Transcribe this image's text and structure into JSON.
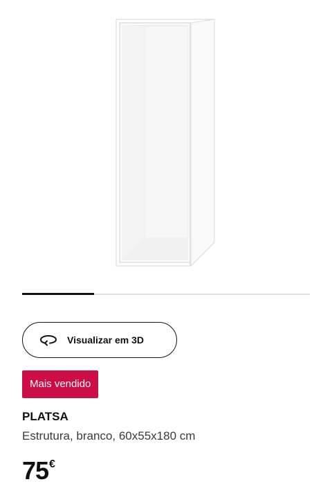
{
  "product": {
    "view_3d_label": "Visualizar em 3D",
    "badge": "Mais vendido",
    "name": "PLATSA",
    "description": "Estrutura, branco, 60x55x180 cm",
    "price_value": "75",
    "price_currency": "€"
  },
  "carousel": {
    "current_position_fraction": 0.25
  },
  "colors": {
    "badge_background": "#cc0d46",
    "text_primary": "#111111",
    "progress_active": "#111111",
    "progress_track": "#dfdfdf"
  },
  "icons": {
    "view_3d": "rotate-3d-icon"
  }
}
